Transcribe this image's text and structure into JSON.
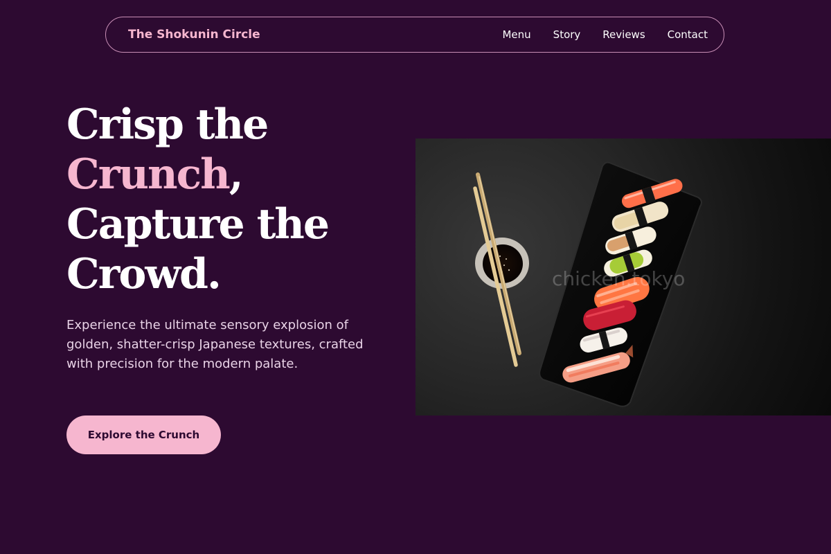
{
  "nav": {
    "brand": "The Shokunin Circle",
    "links": [
      {
        "label": "Menu"
      },
      {
        "label": "Story"
      },
      {
        "label": "Reviews"
      },
      {
        "label": "Contact"
      }
    ]
  },
  "hero": {
    "headline": {
      "line1": "Crisp the",
      "accent": "Crunch",
      "accent_suffix": ",",
      "line3": "Capture the",
      "line4": "Crowd."
    },
    "description": "Experience the ultimate sensory explosion of golden, shatter-crisp Japanese textures, crafted with precision for the modern palate.",
    "cta_label": "Explore the Crunch",
    "image": {
      "watermark": "chicken.tokyo",
      "subject": "sushi nigiri platter with chopsticks and soy sauce"
    }
  },
  "colors": {
    "background": "#2d0a31",
    "accent": "#f6b6cf",
    "text": "#ffffff",
    "muted_text": "#e9d3e7",
    "nav_border": "#c98fb6"
  }
}
